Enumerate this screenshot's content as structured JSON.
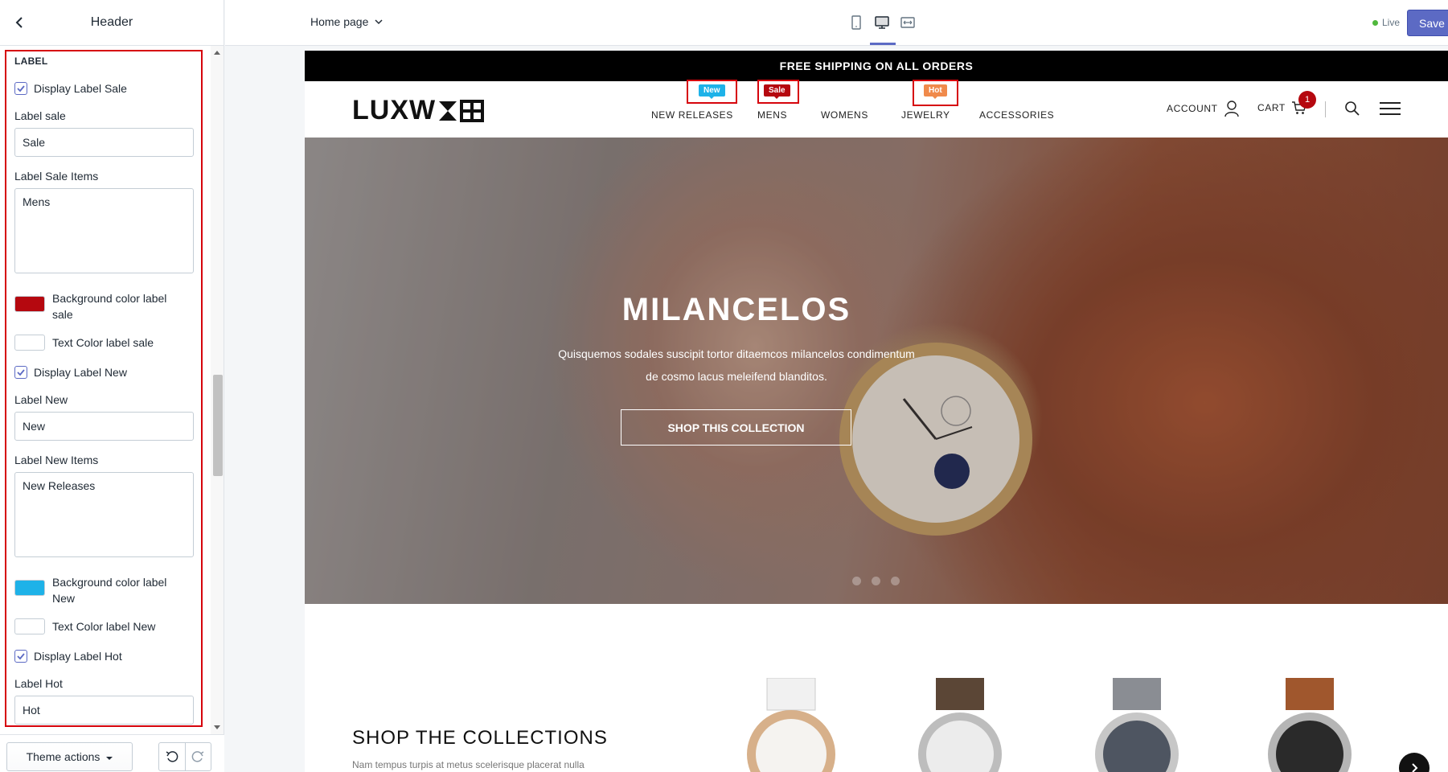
{
  "sidebar": {
    "title": "Header",
    "section_label": "LABEL",
    "display_label_sale": "Display Label Sale",
    "label_sale": {
      "label": "Label sale",
      "value": "Sale"
    },
    "label_sale_items": {
      "label": "Label Sale Items",
      "value": "Mens"
    },
    "bg_color_sale": {
      "label": "Background color label sale",
      "color": "#b5080f"
    },
    "text_color_sale": {
      "label": "Text Color label sale",
      "color": "#ffffff"
    },
    "display_label_new": "Display Label New",
    "label_new": {
      "label": "Label New",
      "value": "New"
    },
    "label_new_items": {
      "label": "Label New Items",
      "value": "New Releases"
    },
    "bg_color_new": {
      "label": "Background color label New",
      "color": "#1eb2e8"
    },
    "text_color_new": {
      "label": "Text Color label New",
      "color": "#ffffff"
    },
    "display_label_hot": "Display Label Hot",
    "label_hot": {
      "label": "Label Hot",
      "value": "Hot"
    },
    "footer": {
      "theme_actions": "Theme actions"
    }
  },
  "topbar": {
    "page_select": "Home page",
    "status": "Live",
    "save": "Save",
    "accent_color": "#5c6ac4"
  },
  "store": {
    "announcement": "FREE SHIPPING ON ALL ORDERS",
    "logo_text": "LUXW",
    "nav": [
      "NEW RELEASES",
      "MENS",
      "WOMENS",
      "JEWELRY",
      "ACCESSORIES"
    ],
    "badges": {
      "new": "New",
      "sale": "Sale",
      "hot": "Hot"
    },
    "account": "ACCOUNT",
    "cart": "CART",
    "cart_count": "1",
    "hero": {
      "title": "MILANCELOS",
      "subtitle": "Quisquemos sodales suscipit tortor ditaemcos milancelos condimentum de cosmo lacus meleifend blanditos.",
      "button": "SHOP THIS COLLECTION"
    },
    "collections": {
      "title": "SHOP THE COLLECTIONS",
      "text": "Nam tempus turpis at metus scelerisque placerat nulla"
    }
  }
}
